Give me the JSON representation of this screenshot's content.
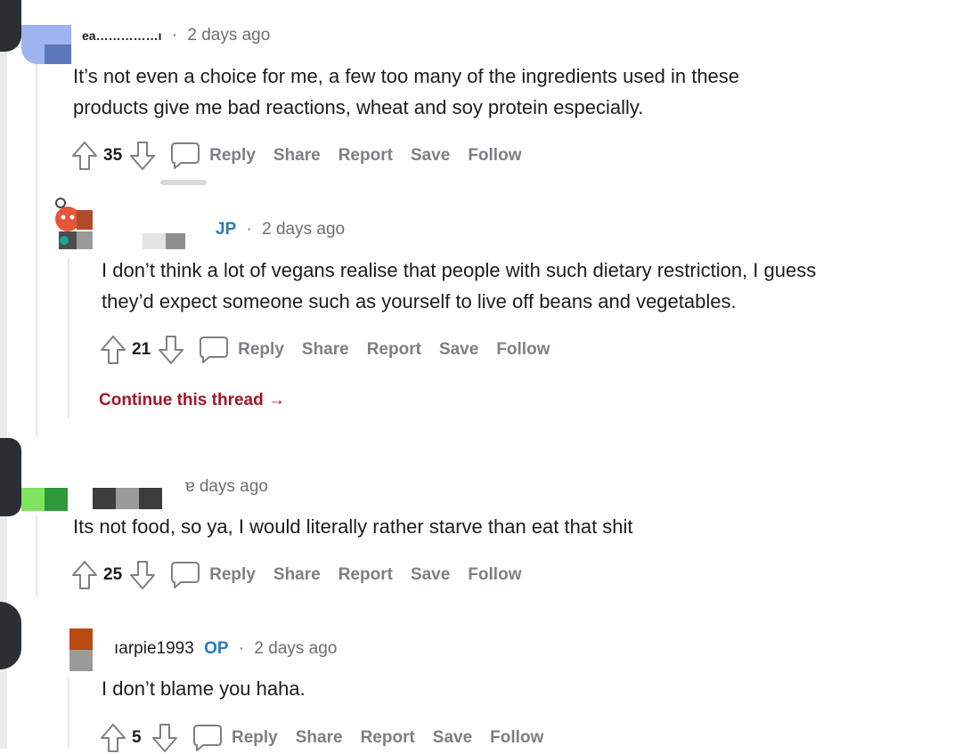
{
  "comments": [
    {
      "username": "ea……………ı",
      "op_badge": "",
      "time": "2 days ago",
      "text_lines": [
        "It’s not even a choice for me, a few too many of the ingredients used in these",
        "products give me bad reactions, wheat and soy protein especially."
      ],
      "score": "35"
    },
    {
      "username": "",
      "op_badge": "JP",
      "time": "2 days ago",
      "text_lines": [
        "I don’t think a lot of vegans realise that people with such dietary restriction, I guess",
        "they’d expect someone such as yourself to live off beans and vegetables."
      ],
      "score": "21",
      "continue_label": "Continue this thread →"
    },
    {
      "username": "",
      "op_badge": "",
      "time": "ɐ days ago",
      "text_lines": [
        "Its not food, so ya, I would literally rather starve than eat that shit"
      ],
      "score": "25"
    },
    {
      "username": "ıarpie1993",
      "op_badge": "OP",
      "time": "2 days ago",
      "text_lines": [
        "I don’t blame you haha."
      ],
      "score": "5"
    }
  ],
  "actions": {
    "reply": "Reply",
    "share": "Share",
    "report": "Report",
    "save": "Save",
    "follow": "Follow"
  },
  "separator": "·",
  "icons": {
    "upvote": "arrow-up-icon",
    "downvote": "arrow-down-icon",
    "reply": "comment-bubble-icon"
  },
  "colors": {
    "continue_link": "#a3152a",
    "op_badge": "#2a7ab8",
    "muted_text": "#6b6f73"
  }
}
